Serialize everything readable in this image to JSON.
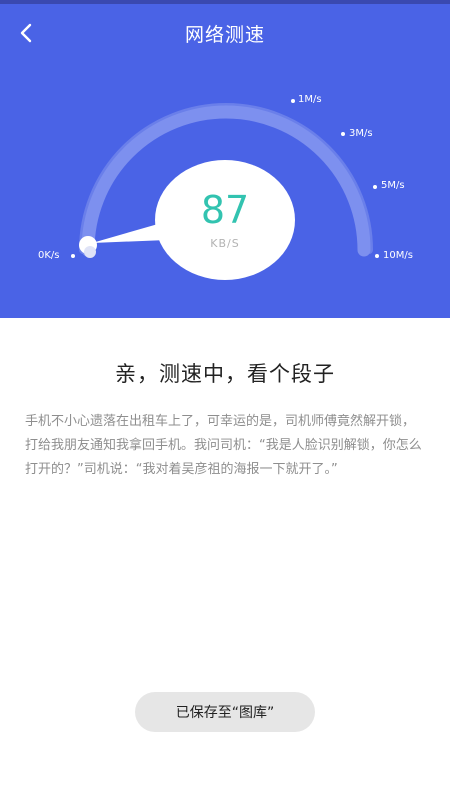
{
  "header": {
    "title": "网络测速",
    "back_icon": "chevron-left-icon"
  },
  "gauge": {
    "ticks": [
      "0K/s",
      "1M/s",
      "3M/s",
      "5M/s",
      "10M/s"
    ],
    "speed": "87",
    "unit": "KB/S",
    "progress_fraction": 0.0
  },
  "content": {
    "title": "亲，测速中，看个段子",
    "joke": "手机不小心遗落在出租车上了，可幸运的是，司机师傅竟然解开锁，打给我朋友通知我拿回手机。我问司机：“我是人脸识别解锁，你怎么打开的？”司机说：“我对着吴彦祖的海报一下就开了。”"
  },
  "toast": {
    "text": "已保存至“图库”"
  },
  "colors": {
    "header_bg": "#4a63e6",
    "accent": "#32c3b0"
  }
}
